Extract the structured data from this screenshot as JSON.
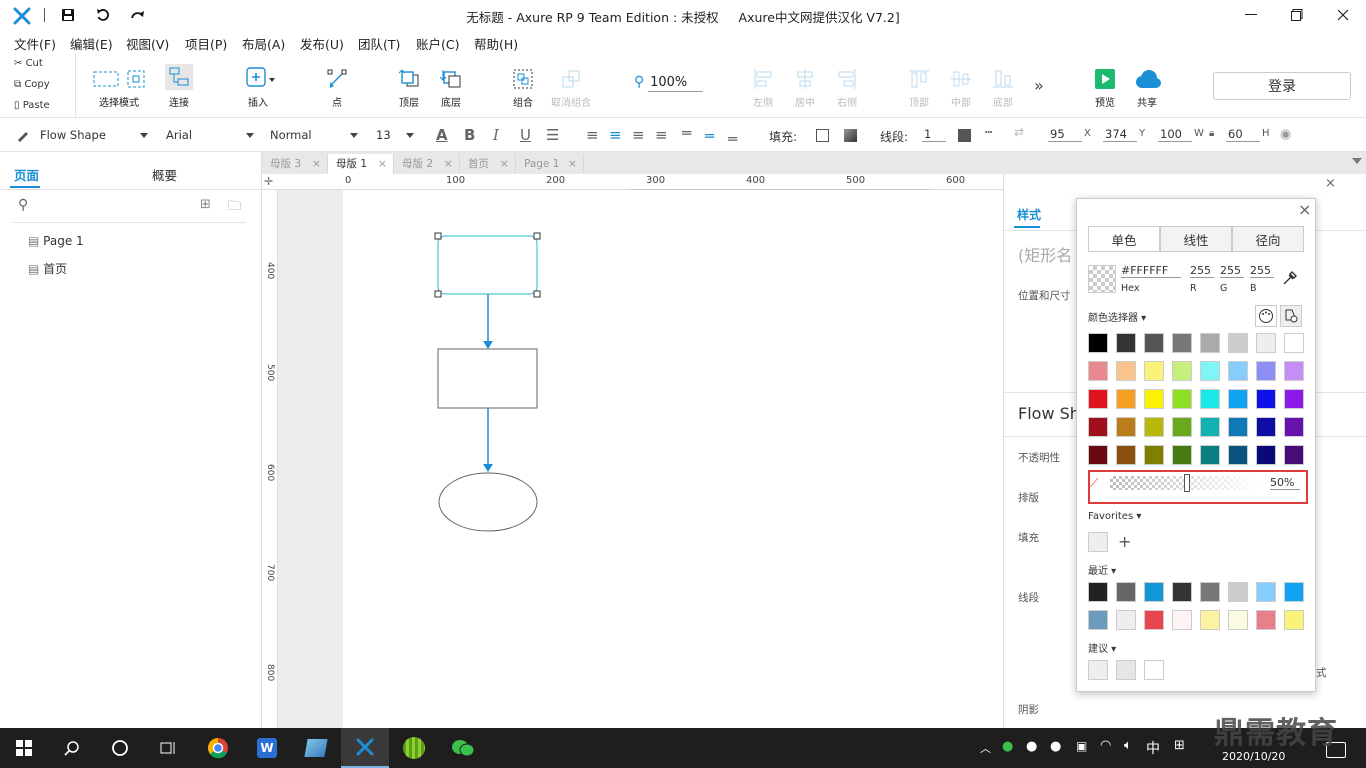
{
  "window": {
    "title": "无标题 - Axure RP 9 Team Edition : 未授权     Axure中文网提供汉化 V7.2]"
  },
  "menu": [
    "文件(F)",
    "编辑(E)",
    "视图(V)",
    "项目(P)",
    "布局(A)",
    "发布(U)",
    "团队(T)",
    "账户(C)",
    "帮助(H)"
  ],
  "clipboard": {
    "cut": "Cut",
    "copy": "Copy",
    "paste": "Paste"
  },
  "toolbar": {
    "select_mode": "选择模式",
    "connect": "连接",
    "insert": "插入",
    "point": "点",
    "top_layer": "顶层",
    "bottom_layer": "底层",
    "group": "组合",
    "ungroup": "取消组合",
    "zoom": "100%",
    "align_left": "左侧",
    "align_center": "居中",
    "align_right": "右侧",
    "align_top": "顶部",
    "align_middle": "中部",
    "align_bottom": "底部",
    "preview": "预览",
    "share": "共享",
    "login": "登录"
  },
  "format": {
    "style": "Flow Shape",
    "font": "Arial",
    "weight": "Normal",
    "size": "13",
    "fill_label": "填充:",
    "line_label": "线段:",
    "line_width": "1",
    "x": "95",
    "x_label": "X",
    "y": "374",
    "y_label": "Y",
    "w": "100",
    "w_label": "W",
    "h": "60",
    "h_label": "H"
  },
  "leftpanel": {
    "tabs": [
      "页面",
      "概要"
    ],
    "pages": [
      "Page 1",
      "首页"
    ]
  },
  "doc_tabs": [
    "母版 3",
    "母版 1",
    "母版 2",
    "首页",
    "Page 1"
  ],
  "ruler_h": [
    "0",
    "100",
    "200",
    "300",
    "400",
    "500",
    "600",
    "100"
  ],
  "ruler_v": [
    "400",
    "500",
    "600",
    "700",
    "800"
  ],
  "rightpanel": {
    "tab": "样式",
    "name_placeholder": "(矩形名",
    "pos_size": "位置和尺寸",
    "flow_shape": "Flow Sh",
    "opacity": "不透明性",
    "layout": "排版",
    "fill": "填充",
    "line": "线段",
    "style_tail": "式",
    "shadow": "阴影"
  },
  "picker": {
    "tabs": [
      "单色",
      "线性",
      "径向"
    ],
    "hex": "#FFFFFF",
    "hex_label": "Hex",
    "r": "255",
    "g": "255",
    "b": "255",
    "r_label": "R",
    "g_label": "G",
    "b_label": "B",
    "selector_label": "颜色选择器",
    "opacity": "50%",
    "favorites": "Favorites",
    "recent": "最近",
    "suggest": "建议",
    "colors": {
      "row1": [
        "#000000",
        "#333333",
        "#555555",
        "#777777",
        "#aaaaaa",
        "#cccccc",
        "#eeeeee",
        "#ffffff"
      ],
      "row2": [
        "#e8888f",
        "#f9c58c",
        "#fbf27a",
        "#c6ef7c",
        "#7ff5f5",
        "#87cdfb",
        "#8c8ef5",
        "#c58ef5"
      ],
      "row3": [
        "#e0121b",
        "#f59f23",
        "#fbf200",
        "#8fe022",
        "#18e9e9",
        "#12a3f2",
        "#1010ea",
        "#8b1aea"
      ],
      "row4": [
        "#a0101a",
        "#bb7c1c",
        "#b8b80c",
        "#6aa81c",
        "#12b2b2",
        "#107ab8",
        "#0e0ea5",
        "#6812ad"
      ],
      "row5": [
        "#6a0a10",
        "#8a5010",
        "#808000",
        "#487a14",
        "#0a7f7f",
        "#0a5380",
        "#09097a",
        "#470c7a"
      ],
      "recent1": [
        "#222222",
        "#666666",
        "#1196d6",
        "#333333",
        "#777777",
        "#cccccc",
        "#87cdfb",
        "#12a3f2"
      ],
      "recent2": [
        "#6a9bbd",
        "#eeeeee",
        "#e8464f",
        "#fdf3f3",
        "#fbf3a0",
        "#fbfbe0",
        "#e8808a",
        "#fbf27a"
      ]
    }
  },
  "taskbar": {
    "ime": "中",
    "time": "2020/10/20",
    "watermark": "鼎需教育"
  }
}
